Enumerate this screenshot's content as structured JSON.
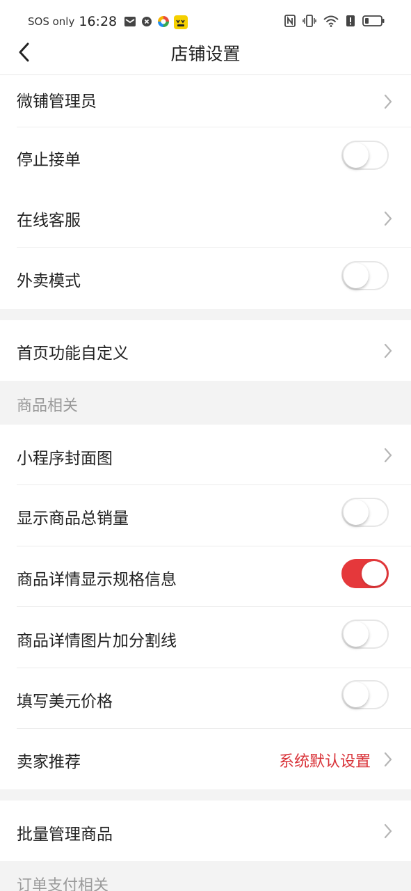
{
  "status_bar": {
    "carrier": "SOS only",
    "time": "16:28",
    "left_icons": [
      "mail-icon",
      "shield-icon",
      "colorful-app-icon",
      "emoji-app-icon"
    ],
    "right_icons": [
      "nfc-icon",
      "vibrate-icon",
      "wifi-icon",
      "alert-icon",
      "battery-icon"
    ]
  },
  "nav": {
    "title": "店铺设置"
  },
  "rows": {
    "admin": "微铺管理员",
    "stop_orders": "停止接单",
    "online_service": "在线客服",
    "takeout_mode": "外卖模式",
    "homepage_custom": "首页功能自定义",
    "cover_image": "小程序封面图",
    "show_total_sales": "显示商品总销量",
    "show_spec_info": "商品详情显示规格信息",
    "image_dividers": "商品详情图片加分割线",
    "usd_price": "填写美元价格",
    "seller_recommend": "卖家推荐",
    "seller_recommend_value": "系统默认设置",
    "batch_manage": "批量管理商品"
  },
  "toggles": {
    "stop_orders": false,
    "takeout_mode": false,
    "show_total_sales": false,
    "show_spec_info": true,
    "image_dividers": false,
    "usd_price": false
  },
  "sections": {
    "product": "商品相关",
    "order_payment": "订单支付相关"
  },
  "colors": {
    "accent": "#e5383b",
    "section_bg": "#f3f3f3",
    "value_red": "#d9343a"
  }
}
